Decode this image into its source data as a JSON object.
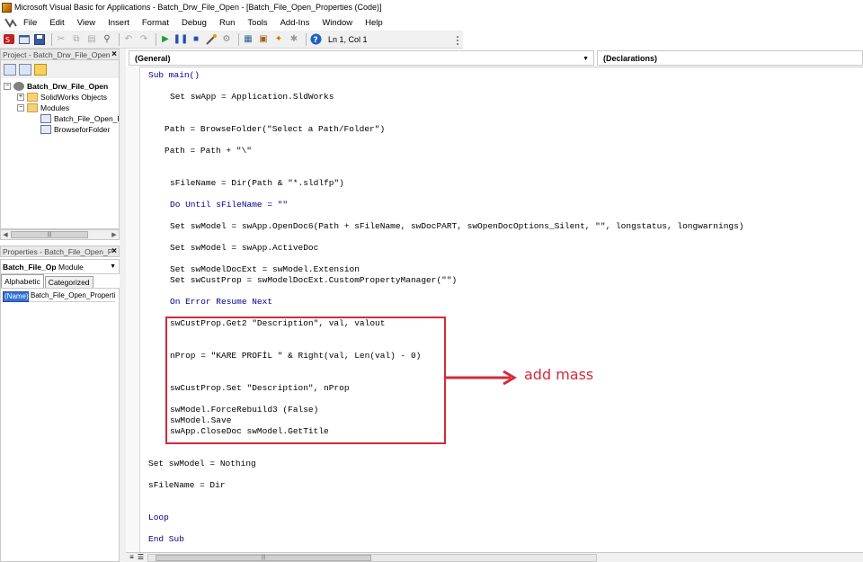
{
  "window": {
    "title": "Microsoft Visual Basic for Applications - Batch_Drw_File_Open - [Batch_File_Open_Properties (Code)]"
  },
  "menu": [
    "File",
    "Edit",
    "View",
    "Insert",
    "Format",
    "Debug",
    "Run",
    "Tools",
    "Add-Ins",
    "Window",
    "Help"
  ],
  "toolbar": {
    "cursor_position": "Ln 1, Col 1"
  },
  "project": {
    "title": "Project - Batch_Drw_File_Open",
    "tree": {
      "root": "Batch_Drw_File_Open",
      "folder_objects": "SolidWorks Objects",
      "folder_modules": "Modules",
      "module_1": "Batch_File_Open_Pr",
      "module_2": "BrowseforFolder"
    }
  },
  "properties": {
    "title": "Properties - Batch_File_Open_P",
    "object": "Batch_File_Op",
    "object_kind": "Module",
    "tabs": [
      "Alphabetic",
      "Categorized"
    ],
    "row_name": "(Name)",
    "row_value": "Batch_File_Open_Properti"
  },
  "code": {
    "combo_general": "(General)",
    "combo_declarations": "(Declarations)",
    "lines": [
      "Sub main()",
      "Set swApp = Application.SldWorks",
      "Path = BrowseFolder(\"Select a Path/Folder\")",
      "Path = Path + \"\\\"",
      "sFileName = Dir(Path & \"*.sldlfp\")",
      "Do Until sFileName = \"\"",
      "Set swModel = swApp.OpenDoc6(Path + sFileName, swDocPART, swOpenDocOptions_Silent, \"\", longstatus, longwarnings)",
      "Set swModel = swApp.ActiveDoc",
      "Set swModelDocExt = swModel.Extension",
      "Set swCustProp = swModelDocExt.CustomPropertyManager(\"\")",
      "On Error Resume Next",
      "swCustProp.Get2 \"Description\", val, valout",
      "nProp = \"KARE PROFİL \" & Right(val, Len(val) - 0)",
      "swCustProp.Set \"Description\", nProp",
      "swModel.ForceRebuild3 (False)",
      "swModel.Save",
      "swApp.CloseDoc swModel.GetTitle",
      "Set swModel = Nothing",
      "sFileName = Dir",
      "Loop",
      "End Sub"
    ]
  },
  "annotation": {
    "text": "add mass",
    "color": "#d42a3a"
  }
}
